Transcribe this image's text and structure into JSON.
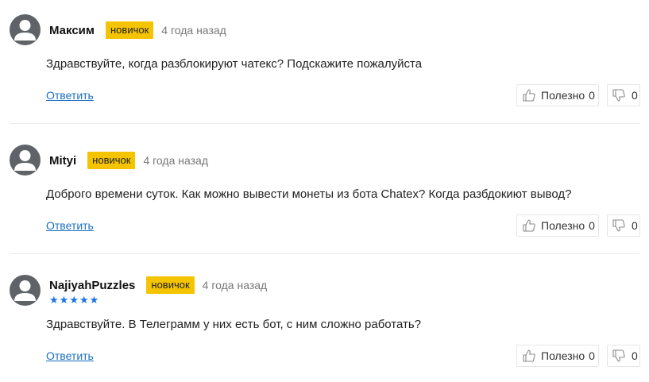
{
  "reply_label": "Ответить",
  "useful_label": "Полезно",
  "comments": [
    {
      "author": "Максим",
      "badge": "новичок",
      "time": "4 года назад",
      "text": "Здравствуйте, когда разблокируют чатекс? Подскажите пожалуйста",
      "likes": "0",
      "dislikes": "0"
    },
    {
      "author": "Mityi",
      "badge": "новичок",
      "time": "4 года назад",
      "text": "Доброго времени суток. Как можно вывести монеты из бота Chatex? Когда разбдокиют вывод?",
      "likes": "0",
      "dislikes": "0"
    },
    {
      "author": "NajiyahPuzzles",
      "badge": "новичок",
      "time": "4 года назад",
      "rating_stars": 5,
      "text": "Здравствуйте. В Телеграмм у них есть бот, с ним сложно работать?",
      "likes": "0",
      "dislikes": "0"
    }
  ],
  "colors": {
    "badge": "#f5c400",
    "link": "#1a6fc4",
    "stars": "#1a73e8",
    "avatar": "#5f6368"
  },
  "icons": {
    "avatar": "user-avatar-icon",
    "like": "thumbs-up-icon",
    "dislike": "thumbs-down-icon",
    "star": "star-icon"
  }
}
